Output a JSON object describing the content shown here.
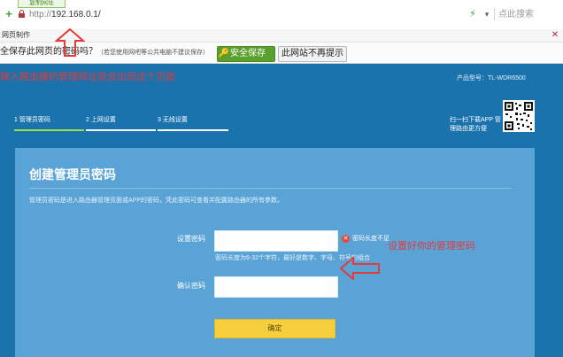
{
  "browser": {
    "tab_chip": "复制网址",
    "url_scheme": "http://",
    "url_host": "192.168.0.1/",
    "search_placeholder": "点此搜索",
    "bookmark_label": "网页制作"
  },
  "savebar": {
    "question": "全保存此网页的密码吗？",
    "note": "（若您使用网吧等公共电脑不建议保存）",
    "save_label": "安全保存",
    "never_label": "此网站不再提示"
  },
  "router": {
    "model": "产品型号：TL-WDR6500",
    "steps": [
      {
        "label": "1 管理员密码"
      },
      {
        "label": "2 上网设置"
      },
      {
        "label": "3 无线设置"
      }
    ],
    "qr_text": "扫一扫下载APP 管理路由更方便",
    "title": "创建管理员密码",
    "description": "管理员密码是进入路由器管理页面或APP的密码，凭此密码可查看并配置路由器的所有参数。",
    "pwd_label": "设置密码",
    "pwd_value": "",
    "error": "密码长度不足",
    "hint": "密码长度为6-32个字符，最好是数字、字母、符号的组合",
    "confirm_label": "确认密码",
    "confirm_value": "",
    "ok_label": "确定"
  },
  "annotations": {
    "top": "输入路由器的管理网址就会出现这个页面",
    "right": "设置好你的管理密码"
  },
  "colors": {
    "page_bg": "#1b73ad",
    "panel_bg": "#5aa3d6",
    "accent_step": "#9be04a",
    "ok_button": "#f6cf3d",
    "annotation": "#e33a3a"
  }
}
